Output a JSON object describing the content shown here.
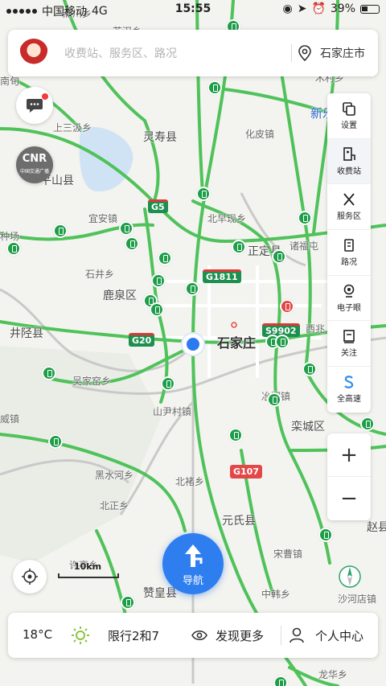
{
  "status": {
    "carrier": "中国移动",
    "network": "4G",
    "time": "15:55",
    "battery": "39%"
  },
  "search": {
    "placeholder": "收费站、服务区、路况",
    "city": "石家庄市"
  },
  "cnr": {
    "logo": "CNR",
    "subtitle": "中国交通广播"
  },
  "toolbar": {
    "items": [
      {
        "label": "设置",
        "icon": "settings-icon"
      },
      {
        "label": "收费站",
        "icon": "toll-station-icon"
      },
      {
        "label": "服务区",
        "icon": "service-area-icon"
      },
      {
        "label": "路况",
        "icon": "traffic-icon"
      },
      {
        "label": "电子眼",
        "icon": "camera-icon"
      },
      {
        "label": "关注",
        "icon": "follow-icon"
      },
      {
        "label": "全高速",
        "icon": "highway-icon"
      }
    ]
  },
  "zoom": {
    "in": "+",
    "out": "−"
  },
  "scale": {
    "label": "10km"
  },
  "nav": {
    "label": "导航"
  },
  "bottom": {
    "temperature": "18°C",
    "limit": "限行2和7",
    "discover": "发现更多",
    "user_center": "个人中心"
  },
  "map": {
    "labels": [
      {
        "text": "燕川乡",
        "cls": "sm"
      },
      {
        "text": "苏汉乡",
        "cls": "sm"
      },
      {
        "text": "南辛",
        "cls": "sm"
      },
      {
        "text": "南旬",
        "cls": "sm"
      },
      {
        "text": "木村乡",
        "cls": "sm"
      },
      {
        "text": "新乐",
        "cls": "blue"
      },
      {
        "text": "上三汲乡",
        "cls": "sm"
      },
      {
        "text": "灵寿县",
        "cls": ""
      },
      {
        "text": "化皮镇",
        "cls": "sm"
      },
      {
        "text": "平山县",
        "cls": ""
      },
      {
        "text": "宜安镇",
        "cls": "sm"
      },
      {
        "text": "北早现乡",
        "cls": "sm"
      },
      {
        "text": "诸福屯",
        "cls": "sm"
      },
      {
        "text": "种场",
        "cls": "sm"
      },
      {
        "text": "石井乡",
        "cls": "sm"
      },
      {
        "text": "正定县",
        "cls": ""
      },
      {
        "text": "鹿泉区",
        "cls": ""
      },
      {
        "text": "西兆",
        "cls": "sm"
      },
      {
        "text": "井陉县",
        "cls": ""
      },
      {
        "text": "石家庄",
        "cls": "big"
      },
      {
        "text": "吴家窑乡",
        "cls": "sm"
      },
      {
        "text": "冶河镇",
        "cls": "sm"
      },
      {
        "text": "威镇",
        "cls": "sm"
      },
      {
        "text": "山尹村镇",
        "cls": "sm"
      },
      {
        "text": "栾城区",
        "cls": ""
      },
      {
        "text": "黑水河乡",
        "cls": "sm"
      },
      {
        "text": "北褚乡",
        "cls": "sm"
      },
      {
        "text": "北正乡",
        "cls": "sm"
      },
      {
        "text": "元氏县",
        "cls": ""
      },
      {
        "text": "赵县",
        "cls": ""
      },
      {
        "text": "宋曹镇",
        "cls": "sm"
      },
      {
        "text": "许亭乡",
        "cls": "sm"
      },
      {
        "text": "赞皇县",
        "cls": ""
      },
      {
        "text": "中韩乡",
        "cls": "sm"
      },
      {
        "text": "沙河店镇",
        "cls": "sm"
      },
      {
        "text": "龙华乡",
        "cls": "sm"
      }
    ],
    "shields": [
      {
        "text": "G5",
        "cls": "g"
      },
      {
        "text": "G1811",
        "cls": "g"
      },
      {
        "text": "G20",
        "cls": "g"
      },
      {
        "text": "S9902",
        "cls": "g"
      },
      {
        "text": "G107",
        "cls": "r"
      }
    ]
  }
}
